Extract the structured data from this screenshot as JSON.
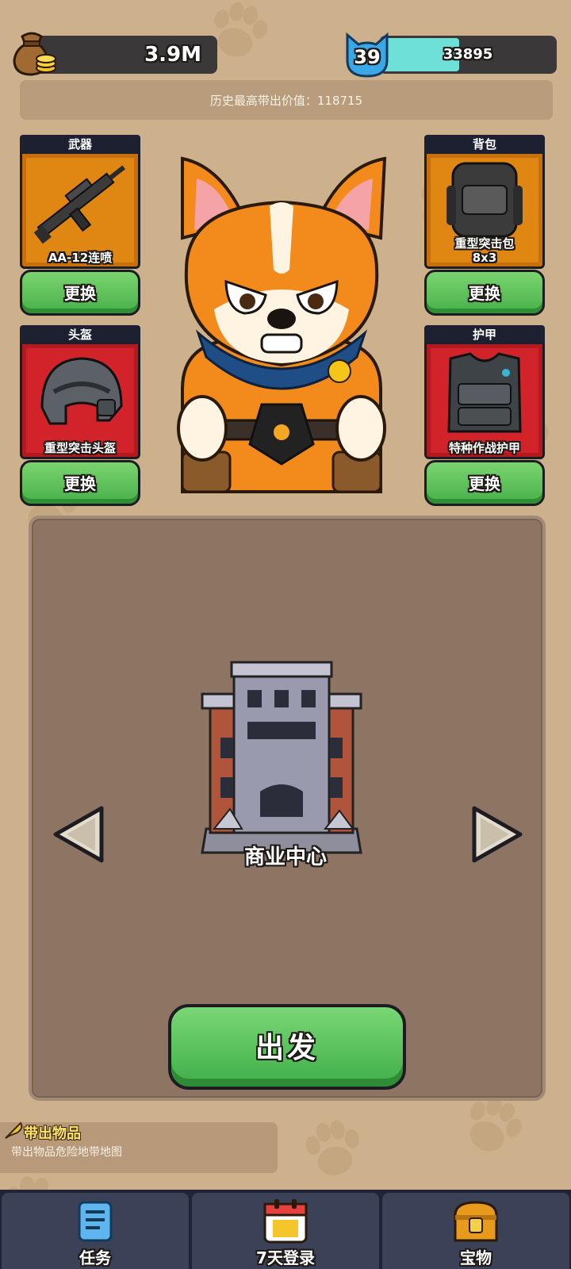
{
  "resources": {
    "coins": "3.9M",
    "level": "39",
    "experience": "33895",
    "xp_progress": 0.45
  },
  "record": {
    "text": "历史最高带出价值：118715"
  },
  "equipment": {
    "weapon": {
      "slot": "武器",
      "item": "AA-12连喷",
      "action": "更换"
    },
    "backpack": {
      "slot": "背包",
      "item": "重型突击包\n8x3",
      "action": "更换"
    },
    "helmet": {
      "slot": "头盔",
      "item": "重型突击头盔",
      "action": "更换"
    },
    "armor": {
      "slot": "护甲",
      "item": "特种作战护甲",
      "action": "更换"
    }
  },
  "map": {
    "name": "商业中心",
    "depart_label": "出发"
  },
  "carry": {
    "title": "带出物品",
    "subtitle": "带出物品危险地带地图"
  },
  "nav": {
    "tasks": "任务",
    "login": "7天登录",
    "treasure": "宝物"
  },
  "colors": {
    "background": "#cdb08c",
    "green_button": "#48b04a",
    "orange_slot": "#e08612",
    "red_slot": "#d2232a",
    "xp_fill": "#6fe0d8",
    "nav_bg": "#1f2536"
  }
}
